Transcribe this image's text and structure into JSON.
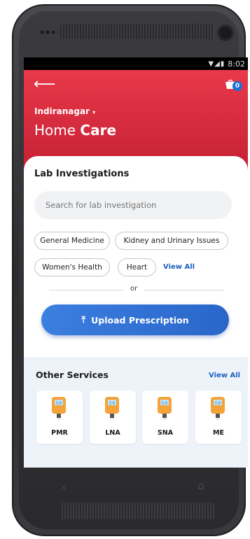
{
  "status": {
    "time": "8:02"
  },
  "header": {
    "location": "Indiranagar",
    "title_light": "Home",
    "title_bold": "Care",
    "cart_count": "0"
  },
  "lab": {
    "title": "Lab Investigations",
    "search_placeholder": "Search for lab investigation",
    "chips": [
      "General Medicine",
      "Kidney and Urinary Issues",
      "Women's Health",
      "Heart"
    ],
    "view_all": "View All",
    "or": "or",
    "upload_label": "Upload Prescription"
  },
  "other": {
    "title": "Other Services",
    "view_all": "View All",
    "services": [
      {
        "label": "PMR",
        "icon": "glucometer-icon"
      },
      {
        "label": "LNA",
        "icon": "glucometer-icon"
      },
      {
        "label": "SNA",
        "icon": "glucometer-icon"
      },
      {
        "label": "ME",
        "icon": "glucometer-icon"
      }
    ],
    "icon_reading": "5.8"
  },
  "colors": {
    "brand_red": "#d62b3d",
    "accent_blue": "#2a66c9",
    "badge_blue": "#1d6fd8"
  }
}
